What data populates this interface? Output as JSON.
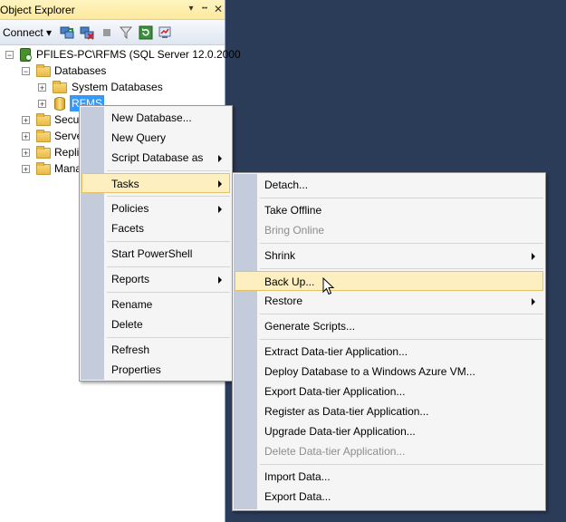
{
  "object_explorer": {
    "title": "Object Explorer",
    "pin_icon": "pin-icon",
    "close_icon": "close-icon",
    "dropdown_icon": "chevron-down-icon",
    "toolbar": {
      "connect_label": "Connect ▾"
    }
  },
  "tree": {
    "server": "PFILES-PC\\RFMS (SQL Server 12.0.2000",
    "databases": "Databases",
    "system_databases": "System Databases",
    "rfms": "RFMS",
    "security": "Secur",
    "server_objects": "Serve",
    "replication": "Repli",
    "management": "Mana"
  },
  "context_menu": {
    "new_database": "New Database...",
    "new_query": "New Query",
    "script_database_as": "Script Database as",
    "tasks": "Tasks",
    "policies": "Policies",
    "facets": "Facets",
    "start_powershell": "Start PowerShell",
    "reports": "Reports",
    "rename": "Rename",
    "delete": "Delete",
    "refresh": "Refresh",
    "properties": "Properties"
  },
  "tasks_menu": {
    "detach": "Detach...",
    "take_offline": "Take Offline",
    "bring_online": "Bring Online",
    "shrink": "Shrink",
    "back_up": "Back Up...",
    "restore": "Restore",
    "generate_scripts": "Generate Scripts...",
    "extract_data_tier": "Extract Data-tier Application...",
    "deploy_azure": "Deploy Database to a Windows Azure VM...",
    "export_data_tier": "Export Data-tier Application...",
    "register_data_tier": "Register as Data-tier Application...",
    "upgrade_data_tier": "Upgrade Data-tier Application...",
    "delete_data_tier": "Delete Data-tier Application...",
    "import_data": "Import Data...",
    "export_data": "Export Data..."
  },
  "colors": {
    "background": "#2b3c59",
    "selection": "#3399ff",
    "menu_highlight": "#fdefc0",
    "menu_gutter": "#c4cbdb"
  }
}
